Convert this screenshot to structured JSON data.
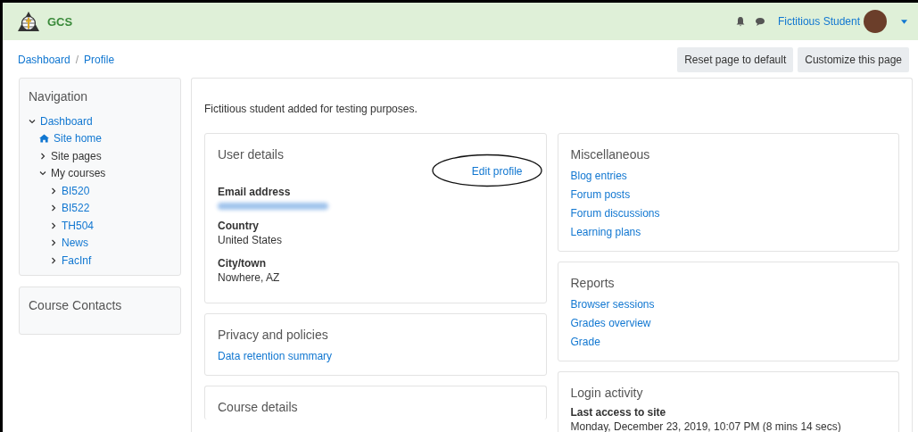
{
  "header": {
    "site_name": "GCS",
    "user_name": "Fictitious Student"
  },
  "breadcrumb": [
    "Dashboard",
    "Profile"
  ],
  "breadcrumb_separator": "/",
  "page_buttons": [
    "Reset page to default",
    "Customize this page"
  ],
  "navigation": {
    "title": "Navigation",
    "items": [
      {
        "label": "Dashboard",
        "kind": "link",
        "expanded": true,
        "children": [
          {
            "label": "Site home",
            "kind": "home"
          },
          {
            "label": "Site pages",
            "kind": "plain",
            "expanded": false
          },
          {
            "label": "My courses",
            "kind": "plain",
            "expanded": true,
            "children": [
              {
                "label": "BI520",
                "kind": "link",
                "expanded": false
              },
              {
                "label": "BI522",
                "kind": "link",
                "expanded": false
              },
              {
                "label": "TH504",
                "kind": "link",
                "expanded": false
              },
              {
                "label": "News",
                "kind": "link",
                "expanded": false
              },
              {
                "label": "FacInf",
                "kind": "link",
                "expanded": false
              }
            ]
          }
        ]
      }
    ]
  },
  "course_contacts": {
    "title": "Course Contacts"
  },
  "description": "Fictitious student added for testing purposes.",
  "user_details": {
    "title": "User details",
    "edit_link": "Edit profile",
    "fields": [
      {
        "label": "Email address",
        "kind": "redacted"
      },
      {
        "label": "Country",
        "kind": "text",
        "value": "United States"
      },
      {
        "label": "City/town",
        "kind": "text",
        "value": "Nowhere, AZ"
      }
    ]
  },
  "privacy": {
    "title": "Privacy and policies",
    "links": [
      "Data retention summary"
    ]
  },
  "course_details": {
    "title": "Course details"
  },
  "miscellaneous": {
    "title": "Miscellaneous",
    "links": [
      "Blog entries",
      "Forum posts",
      "Forum discussions",
      "Learning plans"
    ]
  },
  "reports": {
    "title": "Reports",
    "links": [
      "Browser sessions",
      "Grades overview",
      "Grade"
    ]
  },
  "login_activity": {
    "title": "Login activity",
    "label": "Last access to site",
    "value": "Monday, December 23, 2019, 10:07 PM (8 mins 14 secs)"
  }
}
